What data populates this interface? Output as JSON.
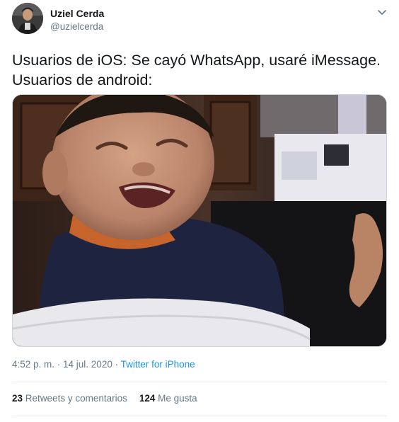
{
  "author": {
    "display_name": "Uziel Cerda",
    "handle": "@uzielcerda"
  },
  "tweet": {
    "text_line1": "Usuarios de iOS: Se cayó WhatsApp, usaré iMessage.",
    "text_line2": "Usuarios de android:",
    "timestamp": "4:52 p. m. · 14 jul. 2020",
    "separator": " · ",
    "source": "Twitter for iPhone"
  },
  "stats": {
    "retweets_count": "23",
    "retweets_label": "Retweets y comentarios",
    "likes_count": "124",
    "likes_label": "Me gusta"
  },
  "icons": {
    "menu": "chevron-down-icon"
  },
  "colors": {
    "text_primary": "#14171a",
    "text_secondary": "#657786",
    "link": "#1b95e0",
    "divider": "#e6ecf0"
  }
}
